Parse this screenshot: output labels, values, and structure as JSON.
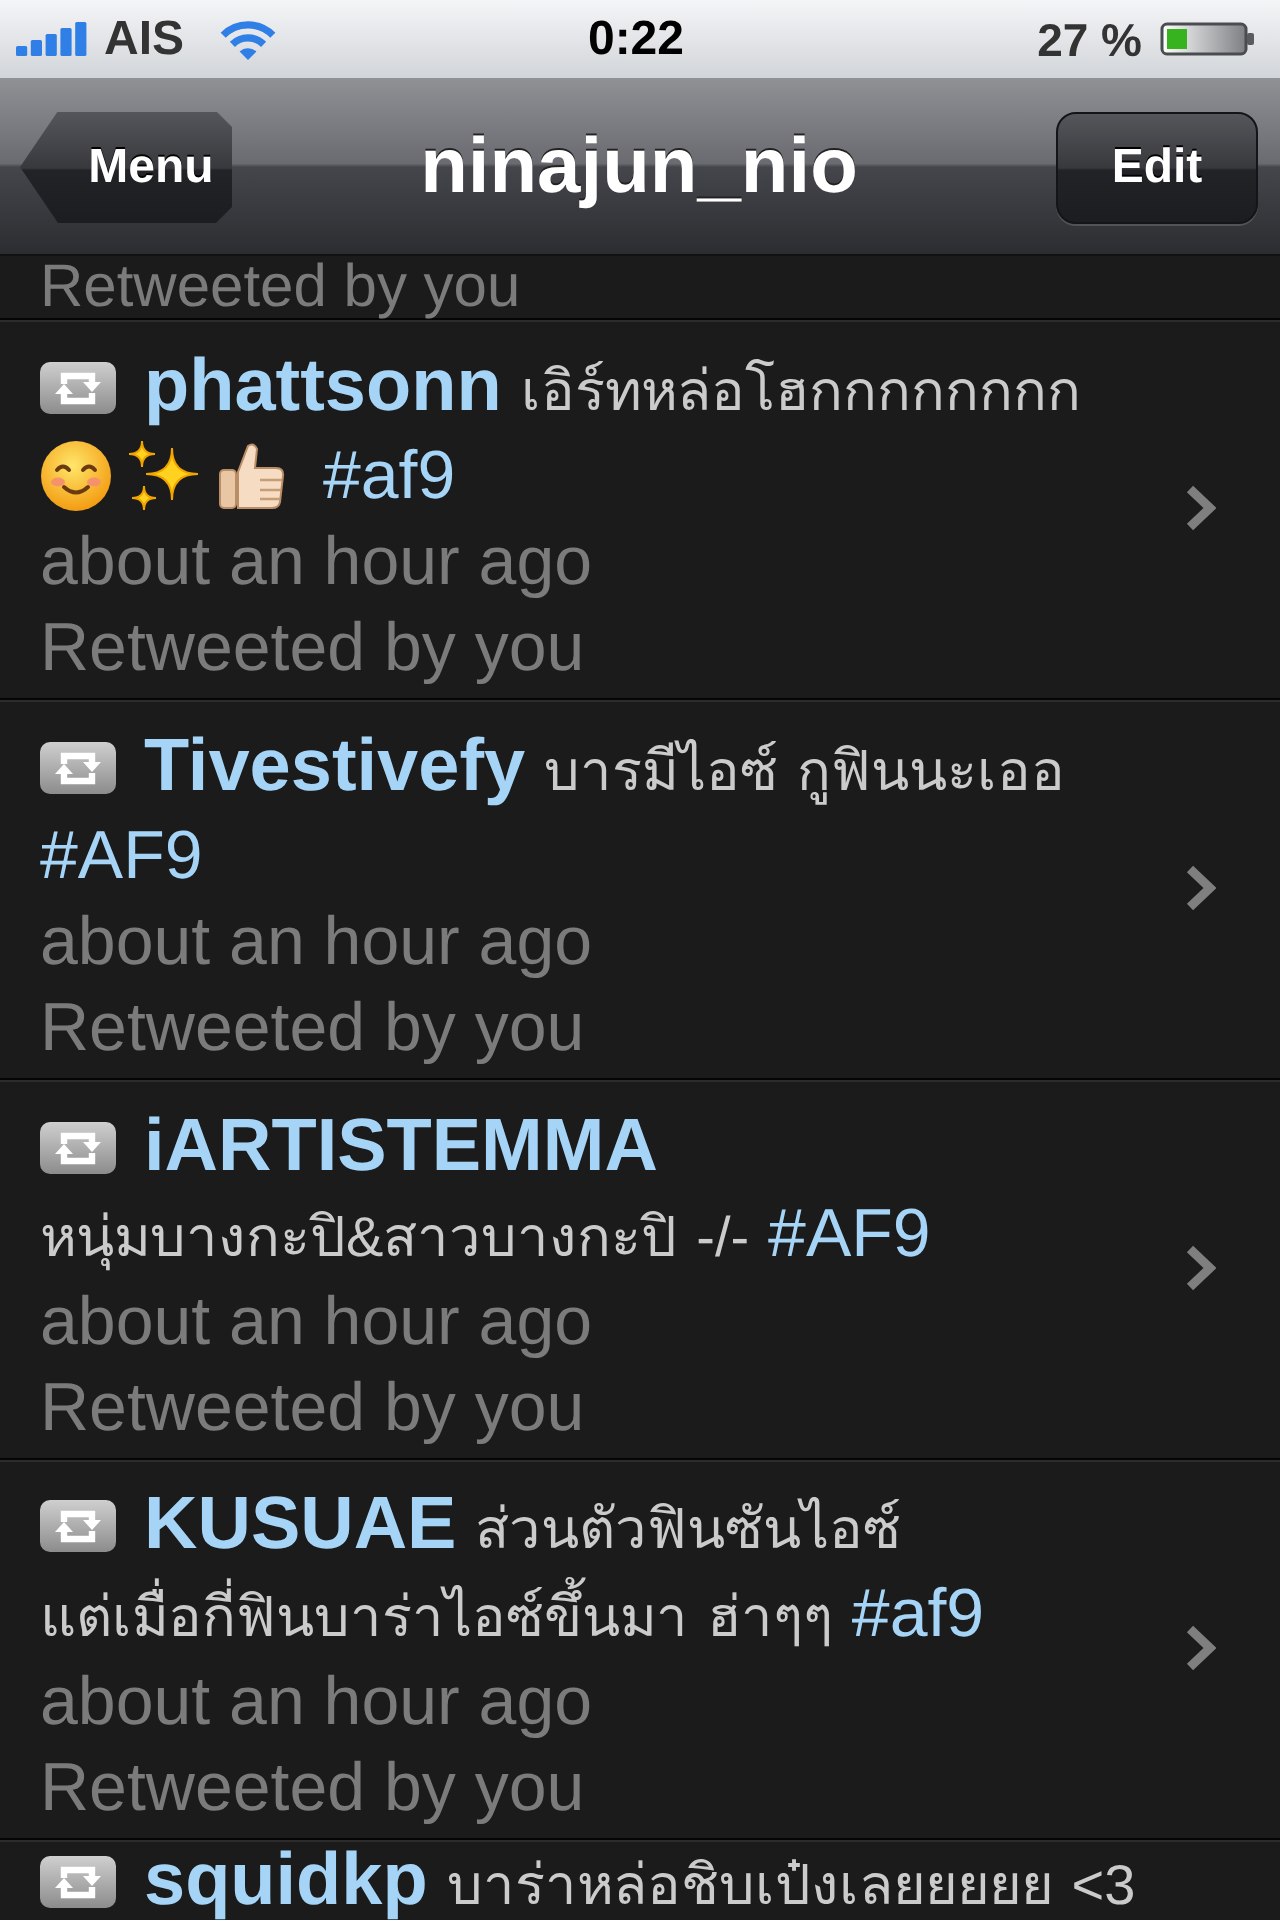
{
  "status_bar": {
    "carrier": "AIS",
    "time": "0:22",
    "battery": "27 %"
  },
  "nav_bar": {
    "back_button": "Menu",
    "title": "ninajun_nio",
    "edit_button": "Edit"
  },
  "cut_off_top_row": {
    "note": "Retweeted by you"
  },
  "tweets": [
    {
      "username": "phattsonn",
      "body": [
        {
          "kind": "text",
          "text": "เอิร์ทหล่อโฮกกกกกกกก"
        },
        {
          "kind": "smiley"
        },
        {
          "kind": "sparkles"
        },
        {
          "kind": "thumbsup"
        },
        {
          "kind": "hashtag",
          "text": "#af9"
        }
      ],
      "time": "about an hour ago",
      "note": "Retweeted by you"
    },
    {
      "username": "Tivestivefy",
      "body": [
        {
          "kind": "text",
          "text": "บารมีไอซ์ กูฟินนะเออ"
        },
        {
          "kind": "hashtag",
          "text": "#AF9"
        }
      ],
      "time": "about an hour ago",
      "note": "Retweeted by you"
    },
    {
      "username": "iARTISTEMMA",
      "body": [
        {
          "kind": "text",
          "text": "หนุ่มบางกะปิ&สาวบางกะปิ -/-"
        },
        {
          "kind": "hashtag",
          "text": "#AF9"
        }
      ],
      "time": "about an hour ago",
      "note": "Retweeted by you"
    },
    {
      "username": "KUSUAE",
      "body": [
        {
          "kind": "text",
          "text": "ส่วนตัวฟินซันไอซ์ แต่เมื่อกี่ฟินบาร่าไอซ์ขึ้นมา ฮ่าๆๆ"
        },
        {
          "kind": "hashtag",
          "text": "#af9"
        }
      ],
      "time": "about an hour ago",
      "note": "Retweeted by you"
    }
  ],
  "cut_off_bottom_row": {
    "username": "squidkp",
    "body": [
      {
        "kind": "text",
        "text": "บาร่าหล่อชิบเป๋งเลยยยยย <3"
      }
    ]
  }
}
